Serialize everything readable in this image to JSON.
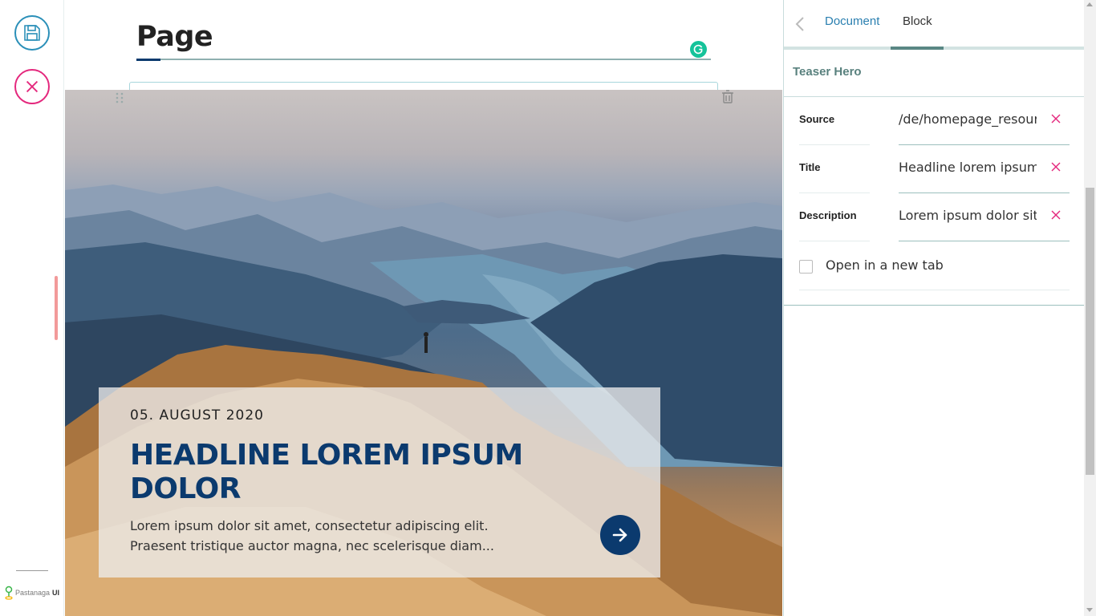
{
  "toolbar": {
    "save_icon": "save-icon",
    "cancel_icon": "close-icon",
    "brand_name": "Pastanaga",
    "brand_suffix": "UI"
  },
  "editor": {
    "page_title": "Page",
    "hero": {
      "date": "05. AUGUST 2020",
      "headline": "HEADLINE LOREM IPSUM DOLOR",
      "description": "Lorem ipsum dolor sit amet, consectetur adipiscing elit. Praesent tristique auctor magna, nec scelerisque diam..."
    }
  },
  "sidebar": {
    "tabs": [
      {
        "label": "Document",
        "active": false
      },
      {
        "label": "Block",
        "active": true
      }
    ],
    "section_title": "Teaser Hero",
    "fields": [
      {
        "label": "Source",
        "value": "/de/homepage_resources"
      },
      {
        "label": "Title",
        "value": "Headline lorem ipsum"
      },
      {
        "label": "Description",
        "value": "Lorem ipsum dolor sit"
      }
    ],
    "checkbox": {
      "label": "Open in a new tab",
      "checked": false
    }
  },
  "colors": {
    "accent_blue": "#0b3a6e",
    "link_blue": "#2a7fb0",
    "teal": "#59817e",
    "save_ring": "#2a8fb8",
    "cancel_ring": "#e4287d"
  }
}
